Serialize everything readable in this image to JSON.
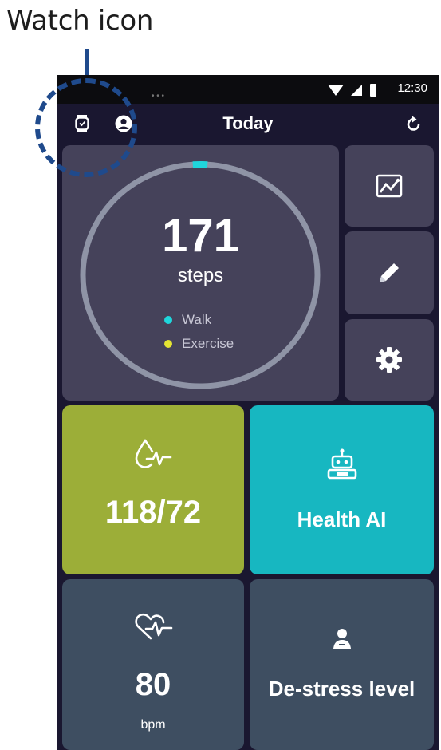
{
  "annotation": {
    "label": "Watch icon"
  },
  "status_bar": {
    "time": "12:30"
  },
  "header": {
    "title": "Today"
  },
  "steps": {
    "value": "171",
    "unit": "steps",
    "progress_fraction": 0.02,
    "legend": [
      {
        "label": "Walk",
        "color": "#1fd6dc"
      },
      {
        "label": "Exercise",
        "color": "#e4e433"
      }
    ]
  },
  "side_buttons": [
    {
      "icon": "trend-chart-icon"
    },
    {
      "icon": "pencil-icon"
    },
    {
      "icon": "gear-icon"
    }
  ],
  "blood_pressure": {
    "value": "118/72",
    "icon": "blood-drop-pulse-icon"
  },
  "health_ai": {
    "label": "Health AI",
    "icon": "robot-icon"
  },
  "heart_rate": {
    "value": "80",
    "unit": "bpm",
    "icon": "heart-pulse-icon"
  },
  "destress": {
    "label": "De-stress level",
    "icon": "person-relax-icon"
  },
  "colors": {
    "background": "#1a1730",
    "tile": "#45425a",
    "blood_pressure_tile": "#9cae38",
    "health_ai_tile": "#17b7c1",
    "heart_rate_tile": "#3e4e61",
    "ring_track": "#8f94a6",
    "ring_progress": "#1fd6dc",
    "annotation": "#1f4a8c"
  }
}
